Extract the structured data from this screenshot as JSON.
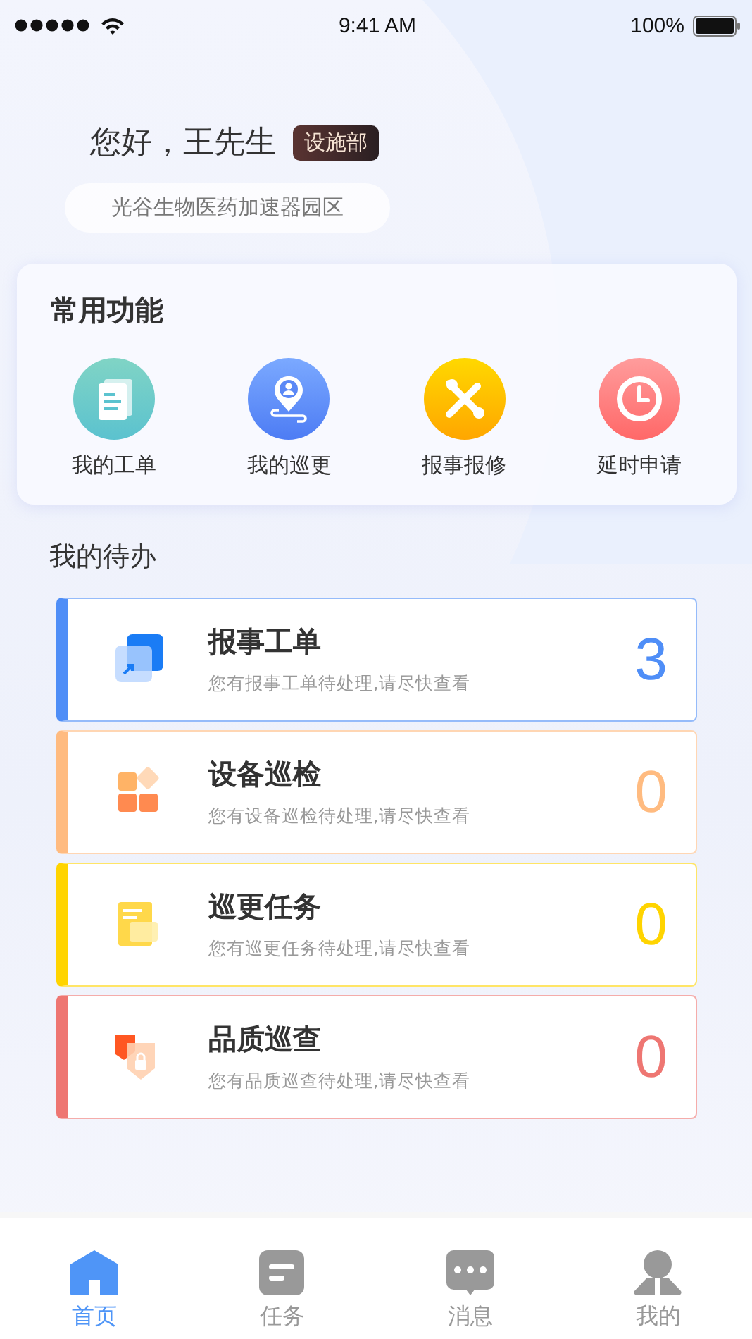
{
  "status_bar": {
    "time": "9:41 AM",
    "battery": "100%"
  },
  "greeting": {
    "text": "您好，王先生",
    "department": "设施部",
    "location": "光谷生物医药加速器园区"
  },
  "quick_functions": {
    "title": "常用功能",
    "items": [
      {
        "kind": "orders",
        "label": "我的工单"
      },
      {
        "kind": "patrol",
        "label": "我的巡更"
      },
      {
        "kind": "repair",
        "label": "报事报修"
      },
      {
        "kind": "delay",
        "label": "延时申请"
      }
    ]
  },
  "todo": {
    "title": "我的待办",
    "items": [
      {
        "kind": "report",
        "title": "报事工单",
        "subtitle": "您有报事工单待处理,请尽快查看",
        "count": "3",
        "color": "#4f8ef7"
      },
      {
        "kind": "equipment",
        "title": "设备巡检",
        "subtitle": "您有设备巡检待处理,请尽快查看",
        "count": "0",
        "color": "#ffbb80"
      },
      {
        "kind": "patrol",
        "title": "巡更任务",
        "subtitle": "您有巡更任务待处理,请尽快查看",
        "count": "0",
        "color": "#ffd400"
      },
      {
        "kind": "quality",
        "title": "品质巡查",
        "subtitle": "您有品质巡查待处理,请尽快查看",
        "count": "0",
        "color": "#ee7672"
      }
    ]
  },
  "tab_bar": [
    {
      "kind": "home",
      "label": "首页",
      "selected": true
    },
    {
      "kind": "tasks",
      "label": "任务",
      "selected": false
    },
    {
      "kind": "messages",
      "label": "消息",
      "selected": false
    },
    {
      "kind": "profile",
      "label": "我的",
      "selected": false
    }
  ]
}
